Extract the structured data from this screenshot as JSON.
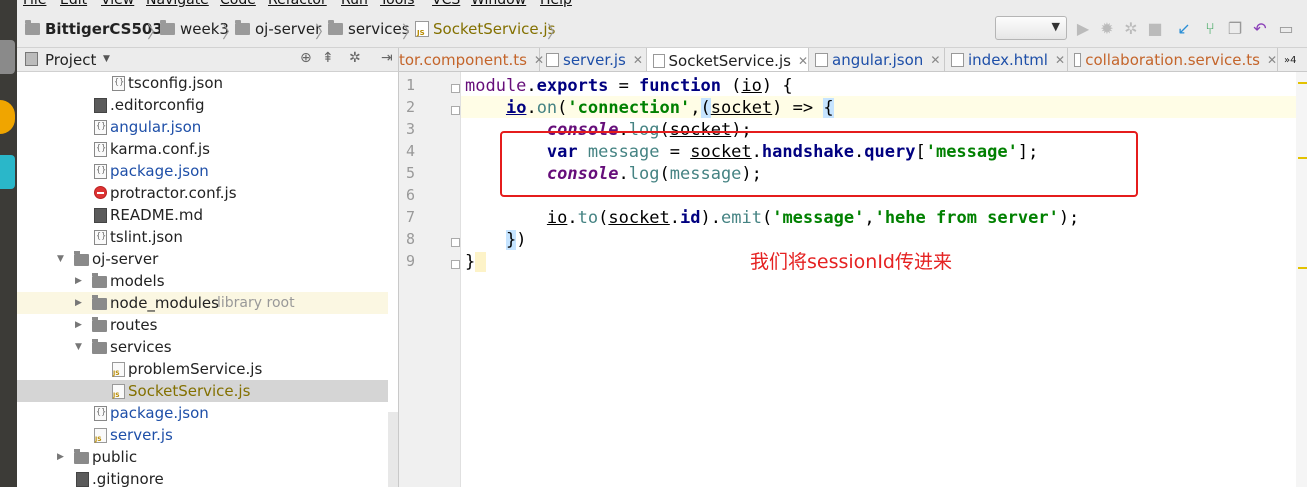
{
  "menu": [
    "File",
    "Edit",
    "View",
    "Navigate",
    "Code",
    "Refactor",
    "Run",
    "Tools",
    "VCS",
    "Window",
    "Help"
  ],
  "breadcrumb": [
    "BittigerCS503",
    "week3",
    "oj-server",
    "services",
    "SocketService.js"
  ],
  "project_panel": {
    "title": "Project",
    "items": [
      {
        "label": "tsconfig.json"
      },
      {
        "label": ".editorconfig"
      },
      {
        "label": "angular.json"
      },
      {
        "label": "karma.conf.js"
      },
      {
        "label": "package.json"
      },
      {
        "label": "protractor.conf.js"
      },
      {
        "label": "README.md"
      },
      {
        "label": "tslint.json"
      },
      {
        "label": "oj-server"
      },
      {
        "label": "models"
      },
      {
        "label": "node_modules",
        "note": "library root"
      },
      {
        "label": "routes"
      },
      {
        "label": "services"
      },
      {
        "label": "problemService.js"
      },
      {
        "label": "SocketService.js"
      },
      {
        "label": "package.json"
      },
      {
        "label": "server.js"
      },
      {
        "label": "public"
      },
      {
        "label": ".gitignore"
      }
    ]
  },
  "tabs": [
    {
      "label": "tor.component.ts"
    },
    {
      "label": "server.js"
    },
    {
      "label": "SocketService.js"
    },
    {
      "label": "angular.json"
    },
    {
      "label": "index.html"
    },
    {
      "label": "collaboration.service.ts"
    },
    {
      "label": "4"
    }
  ],
  "editor": {
    "line_numbers": [
      "1",
      "2",
      "3",
      "4",
      "5",
      "6",
      "7",
      "8",
      "9"
    ]
  },
  "annotation": "我们将sessionId传进来",
  "colors": {
    "accent_red": "#e51c1c",
    "string_green": "#008000",
    "keyword_navy": "#000080"
  }
}
